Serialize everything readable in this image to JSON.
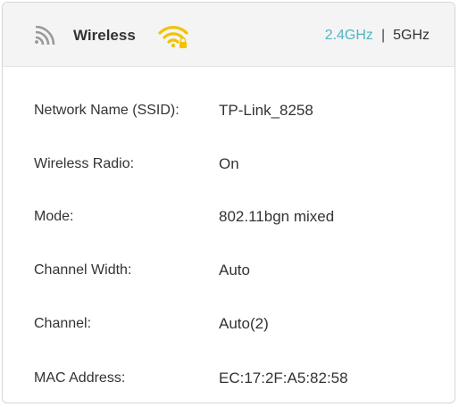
{
  "header": {
    "title": "Wireless",
    "title_icon": "signal-bars-icon",
    "status_icon": "wifi-locked-icon",
    "bands": [
      "2.4GHz",
      "5GHz"
    ],
    "active_band": "2.4GHz",
    "separator": "|"
  },
  "details": [
    {
      "label": "Network Name (SSID):",
      "value": "TP-Link_8258"
    },
    {
      "label": "Wireless Radio:",
      "value": "On"
    },
    {
      "label": "Mode:",
      "value": "802.11bgn mixed"
    },
    {
      "label": "Channel Width:",
      "value": "Auto"
    },
    {
      "label": "Channel:",
      "value": "Auto(2)"
    },
    {
      "label": "MAC Address:",
      "value": "EC:17:2F:A5:82:58"
    }
  ],
  "colors": {
    "active_band": "#4fb6c2",
    "wifi_icon": "#f2c200",
    "header_bg": "#f4f4f4"
  }
}
